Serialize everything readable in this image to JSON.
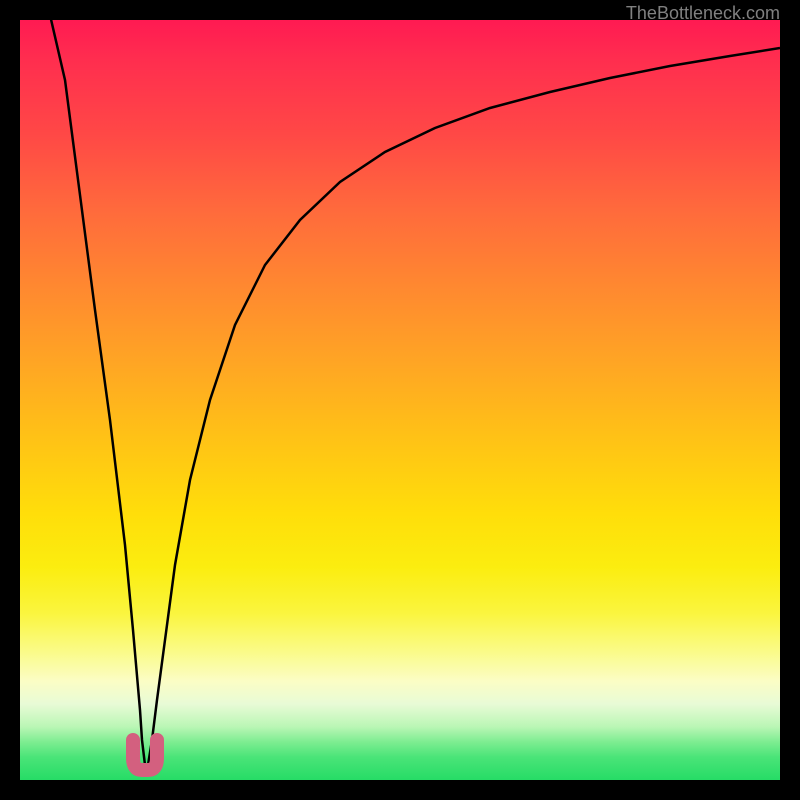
{
  "watermark": "TheBottleneck.com",
  "chart_data": {
    "type": "line",
    "title": "",
    "xlabel": "",
    "ylabel": "",
    "xlim": [
      0,
      100
    ],
    "ylim": [
      0,
      100
    ],
    "description": "Bottleneck curve showing a sharp V-shaped minimum. Left branch descends steeply from top-left to a narrow minimum near x=16, right branch rises with decreasing slope toward upper right.",
    "series": [
      {
        "name": "bottleneck-curve",
        "x": [
          4,
          6,
          8,
          10,
          12,
          14,
          15,
          16,
          17,
          18,
          20,
          22,
          25,
          30,
          35,
          40,
          45,
          50,
          55,
          60,
          65,
          70,
          75,
          80,
          85,
          90,
          95,
          100
        ],
        "y": [
          100,
          85,
          70,
          55,
          40,
          22,
          12,
          3,
          10,
          20,
          35,
          46,
          58,
          70,
          77,
          82,
          85.5,
          88,
          90,
          91.5,
          93,
          94.2,
          95.2,
          96,
          96.7,
          97.2,
          97.8,
          98.3
        ]
      }
    ],
    "annotations": [
      {
        "name": "optimal-marker",
        "x": 16,
        "y": 2,
        "shape": "u-mark",
        "color": "#d3607f"
      }
    ],
    "gradient_legend": {
      "top": "high bottleneck (red)",
      "bottom": "no bottleneck (green)"
    }
  }
}
